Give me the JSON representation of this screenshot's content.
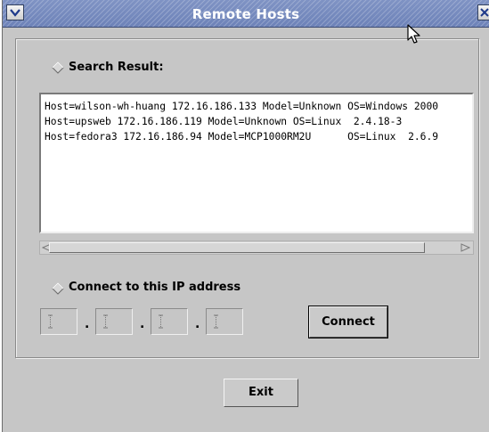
{
  "window": {
    "title": "Remote Hosts"
  },
  "icons": {
    "menu": "chevron-down-icon",
    "close": "close-icon",
    "cursor": "mouse-pointer-icon"
  },
  "search": {
    "label": "Search Result:",
    "results": [
      "Host=wilson-wh-huang 172.16.186.133 Model=Unknown OS=Windows 2000",
      "Host=upsweb 172.16.186.119 Model=Unknown OS=Linux  2.4.18-3",
      "Host=fedora3 172.16.186.94 Model=MCP1000RM2U      OS=Linux  2.6.9"
    ]
  },
  "connect": {
    "label": "Connect to this IP address",
    "ip_octets": [
      "",
      "",
      "",
      ""
    ],
    "separator": ".",
    "button_label": "Connect"
  },
  "footer": {
    "exit_label": "Exit"
  },
  "colors": {
    "titlebar": "#7083bb",
    "window_bg": "#c6c6c6",
    "results_bg": "#ffffff"
  }
}
